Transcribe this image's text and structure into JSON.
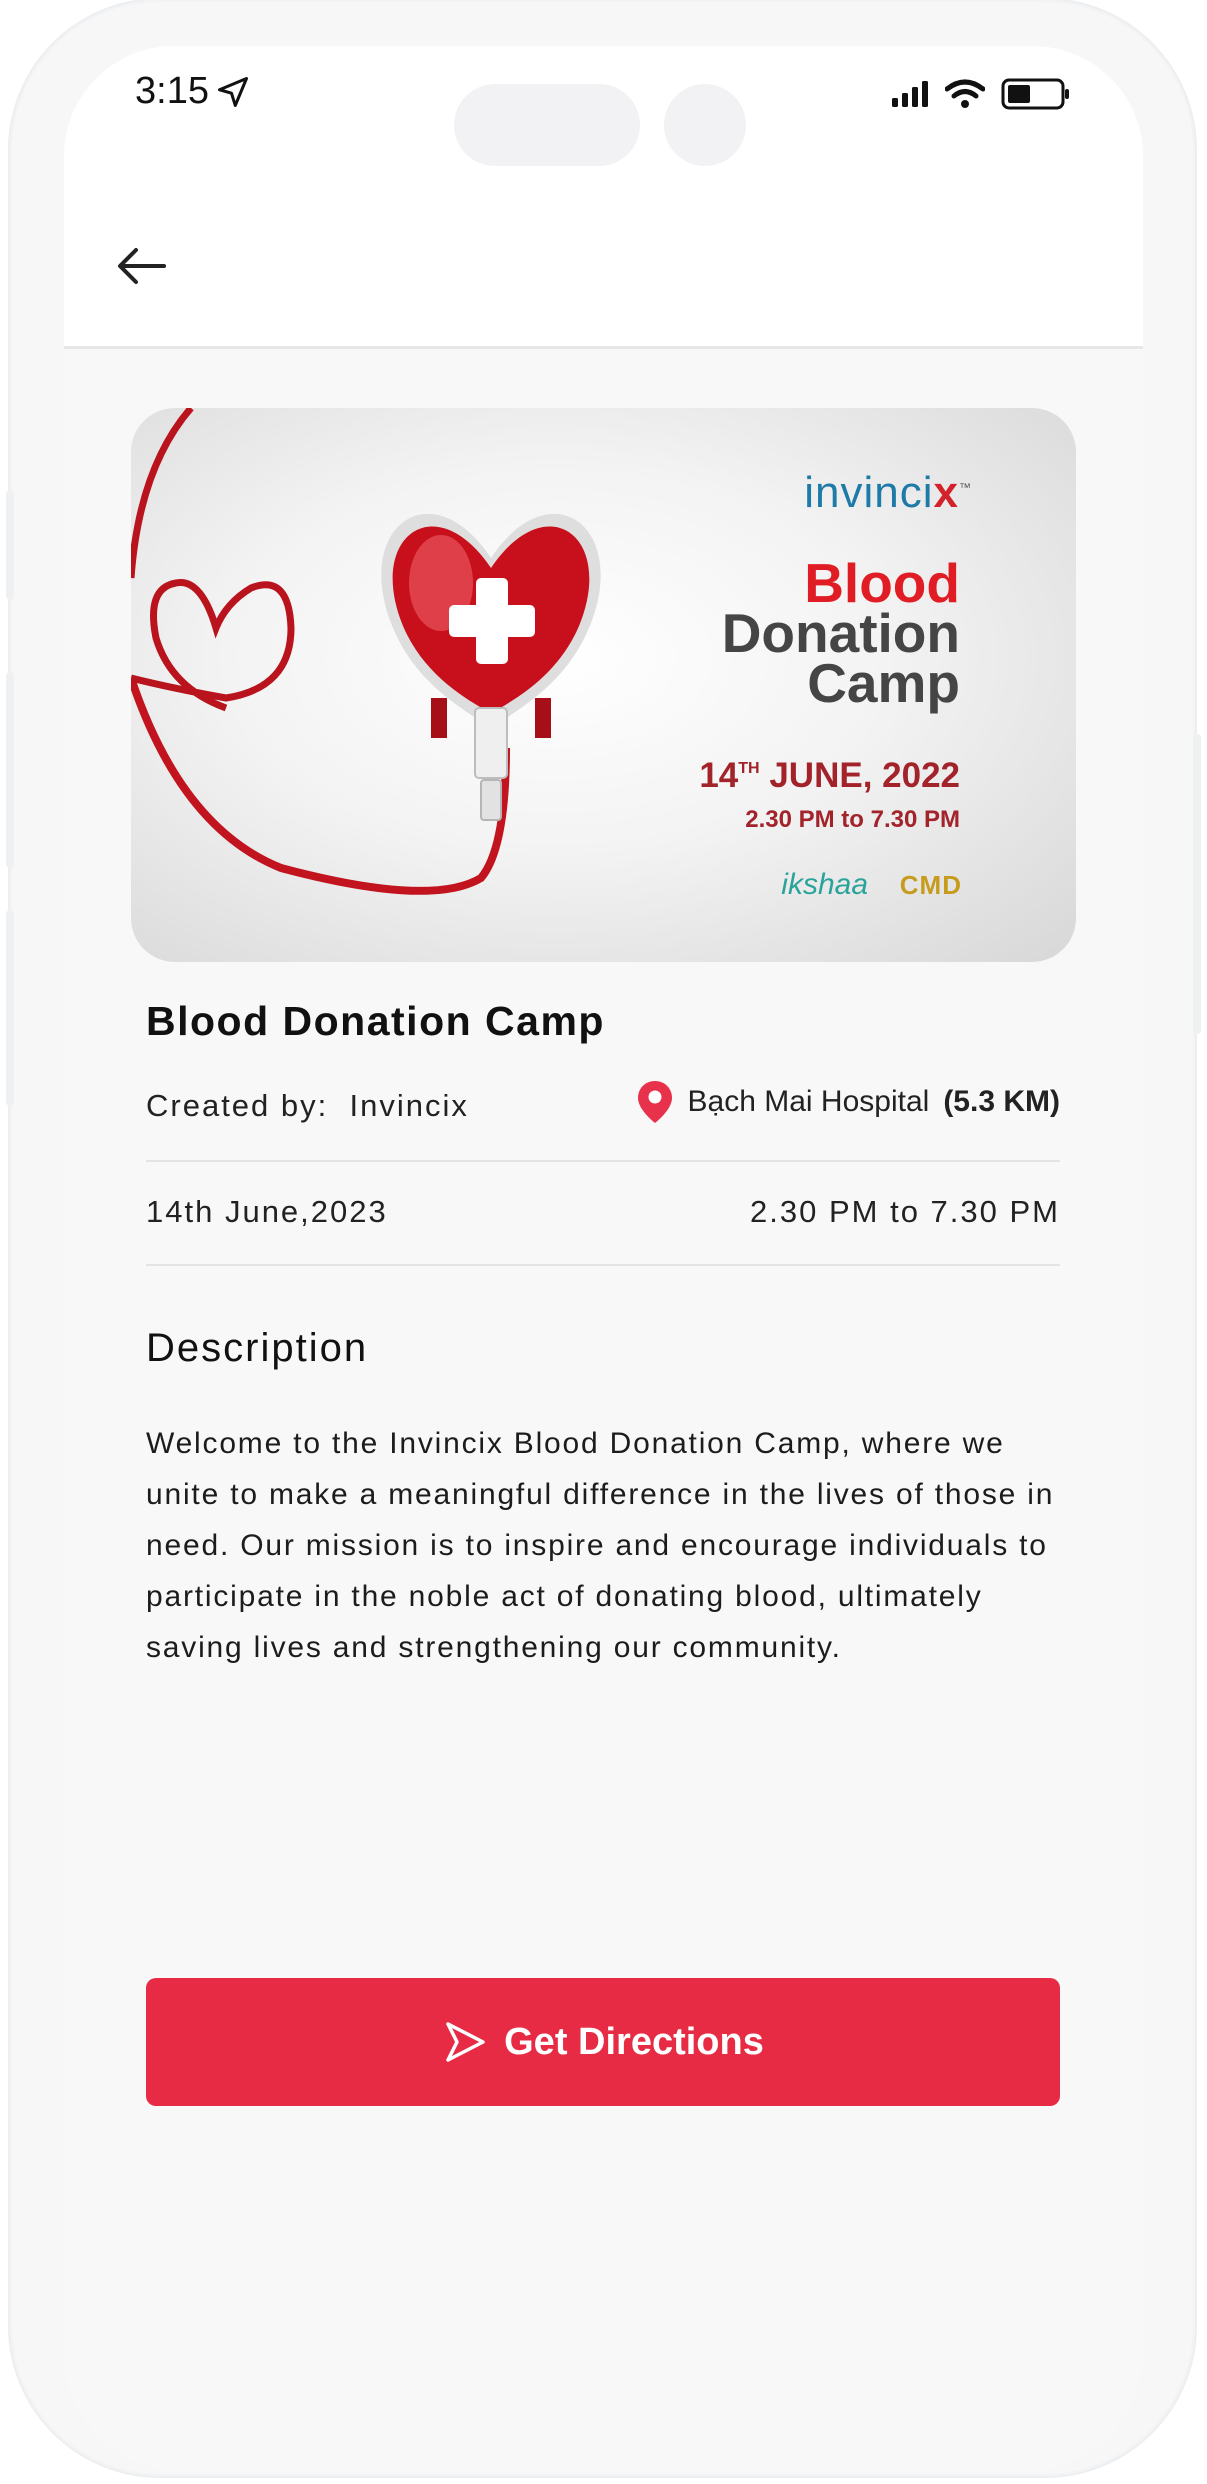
{
  "status_bar": {
    "time": "3:15"
  },
  "event": {
    "title": "Blood Donation Camp",
    "created_by_label": "Created by:",
    "created_by_value": "Invincix",
    "location_name": "Bạch Mai Hospital",
    "location_distance": "(5.3 KM)",
    "date": "14th June,2023",
    "time": "2.30 PM to 7.30 PM"
  },
  "banner": {
    "brand": "invinci",
    "brand_x": "x",
    "brand_tm": "™",
    "title_line1": "Blood",
    "title_line2": "Donation",
    "title_line3": "Camp",
    "date_day": "14",
    "date_suffix": "TH",
    "date_rest": "JUNE, 2022",
    "time": "2.30 PM to 7.30 PM",
    "partner1": "ikshaa",
    "partner2": "CMD"
  },
  "description": {
    "heading": "Description",
    "text": "Welcome to the Invincix Blood Donation Camp, where we unite to make a meaningful difference in the lives of those in need. Our mission is to inspire and encourage individuals to participate in the noble act of donating blood, ultimately saving lives and strengthening our community."
  },
  "cta": {
    "label": "Get Directions"
  },
  "colors": {
    "accent": "#e82b44",
    "pin": "#e8324b",
    "banner_red": "#e01d24"
  }
}
